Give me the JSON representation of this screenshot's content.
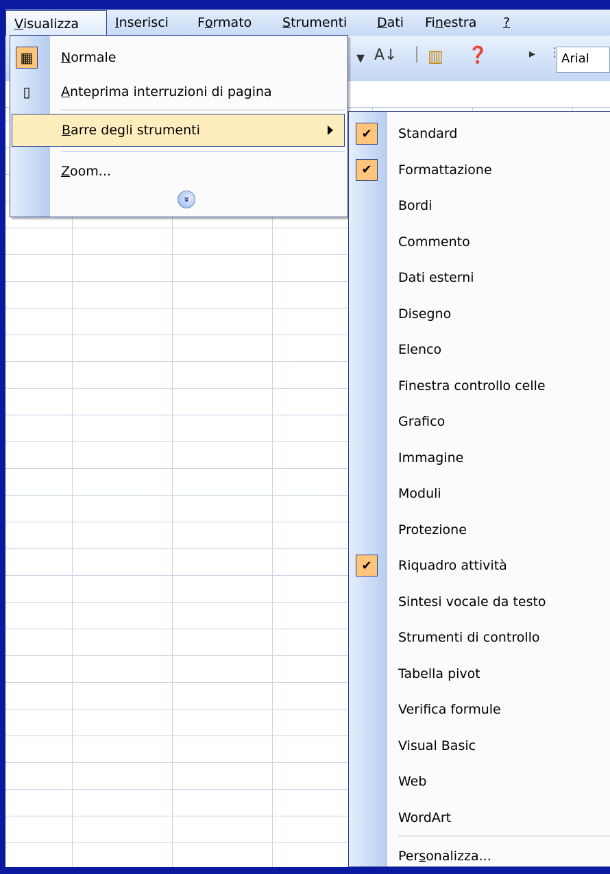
{
  "menubar": {
    "items": [
      {
        "label": "Visualizza",
        "mnemonic": 0,
        "active": true
      },
      {
        "label": "Inserisci",
        "mnemonic": 0,
        "active": false
      },
      {
        "label": "Formato",
        "mnemonic": 1,
        "active": false
      },
      {
        "label": "Strumenti",
        "mnemonic": 0,
        "active": false
      },
      {
        "label": "Dati",
        "mnemonic": 0,
        "active": false
      },
      {
        "label": "Finestra",
        "mnemonic": 2,
        "active": false
      },
      {
        "label": "?",
        "mnemonic": 0,
        "active": false
      }
    ]
  },
  "toolbar": {
    "font_name": "Arial",
    "icons": [
      "sort-ascending-icon",
      "chart-wizard-icon",
      "help-icon",
      "toolbar-options-icon"
    ]
  },
  "view_menu": {
    "items": [
      {
        "label": "Normale",
        "mnemonic": 0,
        "icon": "normal-view-icon",
        "checked": true
      },
      {
        "label": "Anteprima interruzioni di pagina",
        "mnemonic": 0,
        "icon": "page-break-preview-icon",
        "checked": false
      },
      {
        "label": "Barre degli strumenti",
        "mnemonic": 0,
        "highlighted": true,
        "submenu": true
      },
      {
        "label": "Zoom...",
        "mnemonic": 0
      }
    ],
    "expand_icon": "expand-chevrons-icon"
  },
  "toolbars_submenu": {
    "items": [
      {
        "label": "Standard",
        "checked": true
      },
      {
        "label": "Formattazione",
        "checked": true
      },
      {
        "label": "Bordi",
        "checked": false
      },
      {
        "label": "Commento",
        "checked": false
      },
      {
        "label": "Dati esterni",
        "checked": false
      },
      {
        "label": "Disegno",
        "checked": false
      },
      {
        "label": "Elenco",
        "checked": false
      },
      {
        "label": "Finestra controllo celle",
        "checked": false
      },
      {
        "label": "Grafico",
        "checked": false
      },
      {
        "label": "Immagine",
        "checked": false
      },
      {
        "label": "Moduli",
        "checked": false
      },
      {
        "label": "Protezione",
        "checked": false
      },
      {
        "label": "Riquadro attività",
        "checked": true
      },
      {
        "label": "Sintesi vocale da testo",
        "checked": false
      },
      {
        "label": "Strumenti di controllo",
        "checked": false
      },
      {
        "label": "Tabella pivot",
        "checked": false
      },
      {
        "label": "Verifica formule",
        "checked": false
      },
      {
        "label": "Visual Basic",
        "checked": false
      },
      {
        "label": "Web",
        "checked": false
      },
      {
        "label": "WordArt",
        "checked": false
      }
    ],
    "customize": {
      "label": "Personalizza...",
      "mnemonic": 3
    }
  },
  "colors": {
    "highlight": "#ffeebd",
    "check_bg": "#ffc57a",
    "border": "#2b3f8f"
  }
}
